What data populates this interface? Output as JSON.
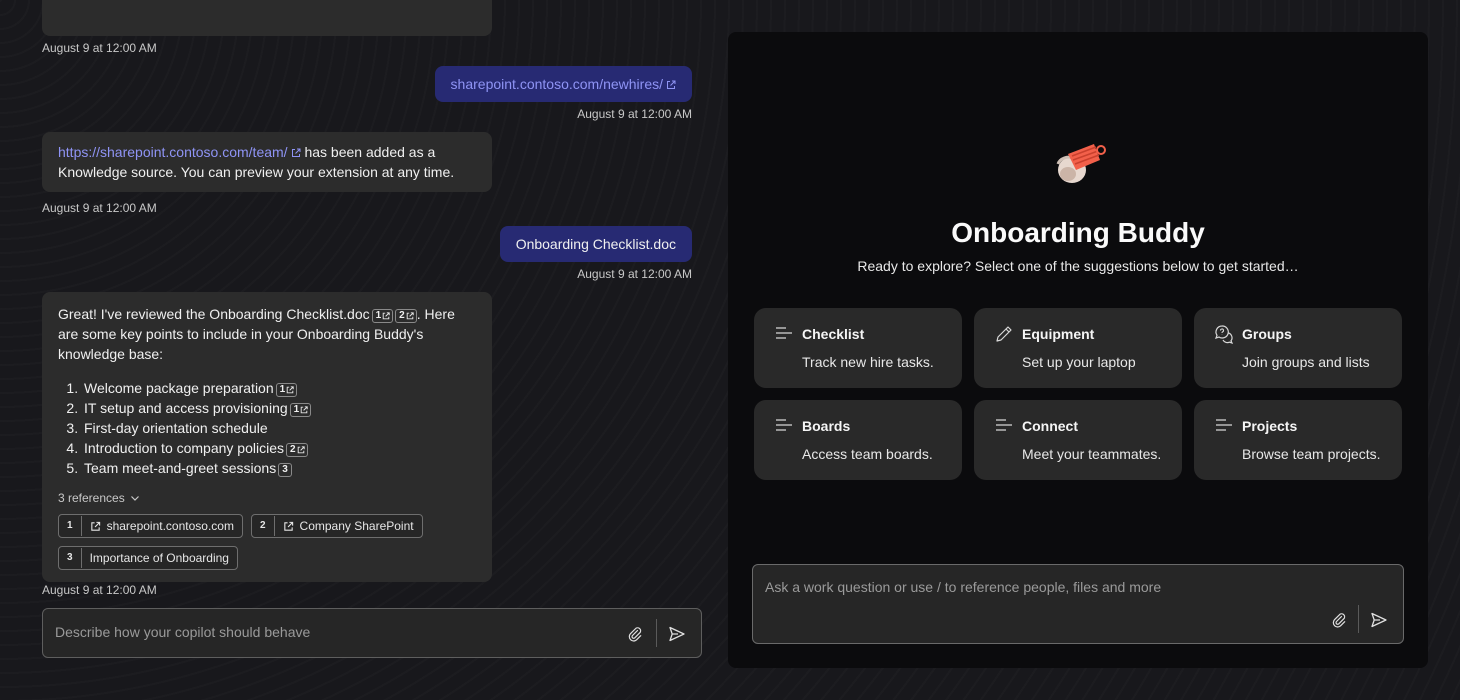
{
  "chat": {
    "messages": [
      {
        "role": "bot",
        "timestamp": "August 9 at 12:00 AM"
      },
      {
        "role": "user",
        "link": "sharepoint.contoso.com/newhires/",
        "timestamp": "August 9 at 12:00 AM"
      },
      {
        "role": "bot",
        "link": "https://sharepoint.contoso.com/team/",
        "text": " has been added as a Knowledge source. You can preview your extension at any time.",
        "timestamp": "August 9 at 12:00 AM"
      },
      {
        "role": "user",
        "text": "Onboarding Checklist.doc",
        "timestamp": "August 9 at 12:00 AM"
      },
      {
        "role": "bot",
        "intro_a": "Great! I've reviewed the Onboarding Checklist.doc",
        "intro_b": ". Here are some key points to include in your Onboarding Buddy's knowledge base:",
        "list": [
          {
            "text": "Welcome package preparation",
            "cites": [
              "1"
            ]
          },
          {
            "text": "IT setup and access provisioning",
            "cites": [
              "1"
            ]
          },
          {
            "text": "First-day orientation schedule",
            "cites": []
          },
          {
            "text": "Introduction to company policies",
            "cites": [
              "2"
            ]
          },
          {
            "text": "Team meet-and-greet sessions",
            "cites": [
              "3"
            ]
          }
        ],
        "intro_cites": [
          "1",
          "2"
        ],
        "references_label": "3 references",
        "references": [
          {
            "num": "1",
            "label": "sharepoint.contoso.com",
            "icon": "external-link-icon"
          },
          {
            "num": "2",
            "label": "Company SharePoint",
            "icon": "external-link-icon"
          },
          {
            "num": "3",
            "label": "Importance of Onboarding",
            "icon": ""
          }
        ],
        "timestamp": "August 9 at 12:00 AM"
      }
    ],
    "composer": {
      "placeholder": "Describe how your copilot should behave"
    }
  },
  "preview": {
    "title": "Onboarding Buddy",
    "subtitle": "Ready to explore? Select one of the suggestions below to get started…",
    "suggestions": [
      {
        "title": "Checklist",
        "desc": "Track new hire tasks.",
        "icon": "text-lines-icon"
      },
      {
        "title": "Equipment",
        "desc": "Set up your laptop",
        "icon": "pencil-icon"
      },
      {
        "title": "Groups",
        "desc": "Join groups and lists",
        "icon": "chat-bubbles-icon"
      },
      {
        "title": "Boards",
        "desc": "Access team boards.",
        "icon": "text-lines-icon"
      },
      {
        "title": "Connect",
        "desc": "Meet your teammates.",
        "icon": "text-lines-icon"
      },
      {
        "title": "Projects",
        "desc": "Browse team projects.",
        "icon": "text-lines-icon"
      }
    ],
    "composer": {
      "placeholder": "Ask a work question or use / to reference people, files and more"
    }
  },
  "colors": {
    "user_bubble": "#272a73",
    "link": "#8f94f5",
    "accent_logo": "#f2604a"
  }
}
